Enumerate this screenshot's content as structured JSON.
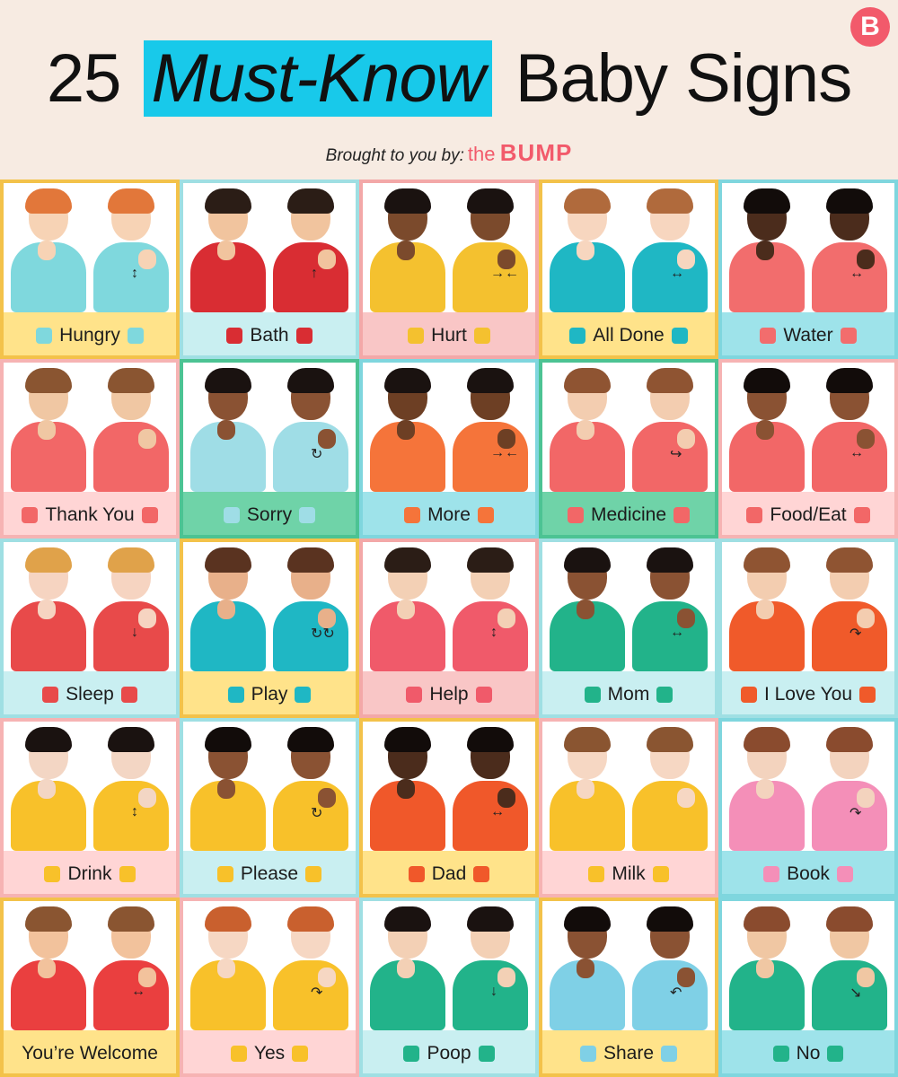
{
  "header": {
    "title_prefix": "25",
    "title_highlight": "Must-Know",
    "title_suffix": "Baby Signs",
    "byline_lead": "Brought to you by:",
    "byline_the": "the",
    "byline_brand": "BUMP",
    "logo_letter": "B"
  },
  "signs": [
    {
      "label": "Hungry",
      "bg": "#ffe38a",
      "border": "#f3c24a",
      "shirt": "#7fd8dd",
      "skin": "#f7d3b5",
      "hair": "#e2773a",
      "icon_left": "food-icon",
      "icon_right": "utensils-icon"
    },
    {
      "label": "Bath",
      "bg": "#c9eff1",
      "border": "#9fdfe3",
      "shirt": "#d92d33",
      "skin": "#f1c49e",
      "hair": "#2b1d16",
      "icon_left": "duck-icon",
      "icon_right": "bubbles-icon"
    },
    {
      "label": "Hurt",
      "bg": "#f9c6c6",
      "border": "#f3a8a8",
      "shirt": "#f4c12f",
      "skin": "#7b4a2c",
      "hair": "#1a1210",
      "icon_left": "plus-icon",
      "icon_right": "pill-icon"
    },
    {
      "label": "All Done",
      "bg": "#ffe38a",
      "border": "#f3c24a",
      "shirt": "#1fb7c4",
      "skin": "#f7d6bf",
      "hair": "#b06a3c",
      "icon_left": "plate-icon",
      "icon_right": "plate-icon"
    },
    {
      "label": "Water",
      "bg": "#9ee3ea",
      "border": "#7fd6de",
      "shirt": "#f26d6d",
      "skin": "#4b2c1c",
      "hair": "#120c0a",
      "icon_left": "cup-icon",
      "icon_right": "glasses-icon"
    },
    {
      "label": "Thank You",
      "bg": "#ffd5d5",
      "border": "#f6b3b3",
      "shirt": "#f26767",
      "skin": "#f0c7a3",
      "hair": "#8a5531",
      "icon_left": "gift-icon",
      "icon_right": "cake-icon"
    },
    {
      "label": "Sorry",
      "bg": "#6fd3a8",
      "border": "#4cc393",
      "shirt": "#9fdde6",
      "skin": "#8a5233",
      "hair": "#1a1210",
      "icon_left": "heart-icon",
      "icon_right": "heart-icon"
    },
    {
      "label": "More",
      "bg": "#9ee3ea",
      "border": "#7fd6de",
      "shirt": "#f5743a",
      "skin": "#6d3f24",
      "hair": "#1a1210",
      "icon_left": "blocks-icon",
      "icon_right": "blocks-icon"
    },
    {
      "label": "Medicine",
      "bg": "#6fd3a8",
      "border": "#4cc393",
      "shirt": "#f26767",
      "skin": "#f3cdb0",
      "hair": "#8f5432",
      "icon_left": "bottle-icon",
      "icon_right": "spoon-icon"
    },
    {
      "label": "Food/Eat",
      "bg": "#ffd5d5",
      "border": "#f6b3b3",
      "shirt": "#f26767",
      "skin": "#8a5233",
      "hair": "#120c0a",
      "icon_left": "food-icon",
      "icon_right": "fruit-icon"
    },
    {
      "label": "Sleep",
      "bg": "#c9eff1",
      "border": "#9fdfe3",
      "shirt": "#e84a4a",
      "skin": "#f6d4c1",
      "hair": "#e0a24a",
      "icon_left": "crib-icon",
      "icon_right": "pillow-icon"
    },
    {
      "label": "Play",
      "bg": "#ffe38a",
      "border": "#f3c24a",
      "shirt": "#1fb7c4",
      "skin": "#e8b08a",
      "hair": "#5a3320",
      "icon_left": "toy-icon",
      "icon_right": "stacker-icon"
    },
    {
      "label": "Help",
      "bg": "#f9c6c6",
      "border": "#f3a8a8",
      "shirt": "#f05a6a",
      "skin": "#f3d0b5",
      "hair": "#2b1d16",
      "icon_left": "info-icon",
      "icon_right": "question-icon"
    },
    {
      "label": "Mom",
      "bg": "#c9eff1",
      "border": "#9fdfe3",
      "shirt": "#22b38a",
      "skin": "#8a5233",
      "hair": "#1a1210",
      "icon_left": "sparkle-icon",
      "icon_right": "sparkle-icon"
    },
    {
      "label": "I Love You",
      "bg": "#c9eff1",
      "border": "#9fdfe3",
      "shirt": "#f05a2a",
      "skin": "#f3cdb0",
      "hair": "#8f5432",
      "icon_left": "heart-icon",
      "icon_right": "heart-icon"
    },
    {
      "label": "Drink",
      "bg": "#ffd5d5",
      "border": "#f6b3b3",
      "shirt": "#f8c12a",
      "skin": "#f3d6c4",
      "hair": "#1a1210",
      "icon_left": "bottle-icon",
      "icon_right": "cup-icon"
    },
    {
      "label": "Please",
      "bg": "#c9eff1",
      "border": "#9fdfe3",
      "shirt": "#f8c12a",
      "skin": "#8a5233",
      "hair": "#120c0a",
      "icon_left": "heart-icon",
      "icon_right": "heart-icon"
    },
    {
      "label": "Dad",
      "bg": "#ffe38a",
      "border": "#f3c24a",
      "shirt": "#f0582a",
      "skin": "#4b2c1c",
      "hair": "#120c0a",
      "icon_left": "star-icon",
      "icon_right": "star-icon"
    },
    {
      "label": "Milk",
      "bg": "#ffd5d5",
      "border": "#f6b3b3",
      "shirt": "#f8c12a",
      "skin": "#f6d7c3",
      "hair": "#8a5531",
      "icon_left": "baby-bottle-icon",
      "icon_right": "baby-bottle-icon"
    },
    {
      "label": "Book",
      "bg": "#9ee3ea",
      "border": "#7fd6de",
      "shirt": "#f48fb8",
      "skin": "#f3d3be",
      "hair": "#8a4b2e",
      "icon_left": "book-icon",
      "icon_right": "books-icon"
    },
    {
      "label": "You’re Welcome",
      "bg": "#ffe38a",
      "border": "#f3c24a",
      "shirt": "#ea3f3f",
      "skin": "#f2c29c",
      "hair": "#8a5531",
      "icon_left": "",
      "icon_right": ""
    },
    {
      "label": "Yes",
      "bg": "#ffd5d5",
      "border": "#f6b3b3",
      "shirt": "#f8c12a",
      "skin": "#f6d7c3",
      "hair": "#c9602e",
      "icon_left": "check-icon",
      "icon_right": "check-icon"
    },
    {
      "label": "Poop",
      "bg": "#c9eff1",
      "border": "#9fdfe3",
      "shirt": "#22b38a",
      "skin": "#f3d0b5",
      "hair": "#1a1210",
      "icon_left": "diaper-icon",
      "icon_right": "toilet-icon"
    },
    {
      "label": "Share",
      "bg": "#ffe38a",
      "border": "#f3c24a",
      "shirt": "#7fd0e6",
      "skin": "#8a5233",
      "hair": "#120c0a",
      "icon_left": "blocks-icon",
      "icon_right": "toy-icon"
    },
    {
      "label": "No",
      "bg": "#9ee3ea",
      "border": "#7fd6de",
      "shirt": "#22b38a",
      "skin": "#f0c7a3",
      "hair": "#8a4b2e",
      "icon_left": "x-icon",
      "icon_right": "x-icon"
    }
  ]
}
